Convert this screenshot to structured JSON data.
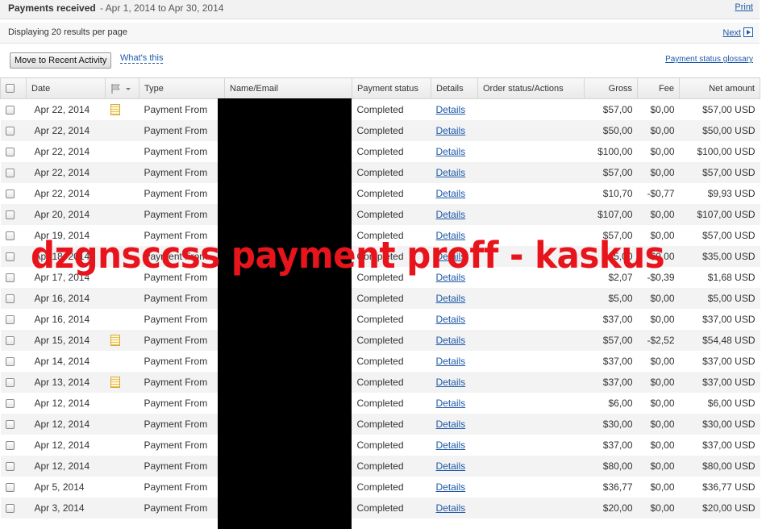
{
  "header": {
    "title": "Payments received",
    "range": "- Apr 1, 2014 to Apr 30, 2014",
    "print_label": "Print"
  },
  "subbar": {
    "per_page": "Displaying 20 results per page",
    "next_label": "Next"
  },
  "toolbar": {
    "recent_button": "Move to Recent Activity",
    "whats_this": "What's this",
    "glossary": "Payment status glossary"
  },
  "columns": {
    "date": "Date",
    "type": "Type",
    "name_email": "Name/Email",
    "status": "Payment status",
    "details": "Details",
    "order": "Order status/Actions",
    "gross": "Gross",
    "fee": "Fee",
    "net": "Net amount"
  },
  "rows": [
    {
      "date": "Apr 22, 2014",
      "note": true,
      "type": "Payment From",
      "status": "Completed",
      "details": "Details",
      "gross": "$57,00",
      "fee": "$0,00",
      "net": "$57,00 USD"
    },
    {
      "date": "Apr 22, 2014",
      "note": false,
      "type": "Payment From",
      "status": "Completed",
      "details": "Details",
      "gross": "$50,00",
      "fee": "$0,00",
      "net": "$50,00 USD"
    },
    {
      "date": "Apr 22, 2014",
      "note": false,
      "type": "Payment From",
      "status": "Completed",
      "details": "Details",
      "gross": "$100,00",
      "fee": "$0,00",
      "net": "$100,00 USD"
    },
    {
      "date": "Apr 22, 2014",
      "note": false,
      "type": "Payment From",
      "status": "Completed",
      "details": "Details",
      "gross": "$57,00",
      "fee": "$0,00",
      "net": "$57,00 USD"
    },
    {
      "date": "Apr 22, 2014",
      "note": false,
      "type": "Payment From",
      "status": "Completed",
      "details": "Details",
      "gross": "$10,70",
      "fee": "-$0,77",
      "net": "$9,93 USD"
    },
    {
      "date": "Apr 20, 2014",
      "note": false,
      "type": "Payment From",
      "status": "Completed",
      "details": "Details",
      "gross": "$107,00",
      "fee": "$0,00",
      "net": "$107,00 USD"
    },
    {
      "date": "Apr 19, 2014",
      "note": false,
      "type": "Payment From",
      "status": "Completed",
      "details": "Details",
      "gross": "$57,00",
      "fee": "$0,00",
      "net": "$57,00 USD"
    },
    {
      "date": "Apr 18, 2014",
      "note": false,
      "type": "Payment From",
      "status": "Completed",
      "details": "Details",
      "gross": "$35,00",
      "fee": "$0,00",
      "net": "$35,00 USD"
    },
    {
      "date": "Apr 17, 2014",
      "note": false,
      "type": "Payment From",
      "status": "Completed",
      "details": "Details",
      "gross": "$2,07",
      "fee": "-$0,39",
      "net": "$1,68 USD"
    },
    {
      "date": "Apr 16, 2014",
      "note": false,
      "type": "Payment From",
      "status": "Completed",
      "details": "Details",
      "gross": "$5,00",
      "fee": "$0,00",
      "net": "$5,00 USD"
    },
    {
      "date": "Apr 16, 2014",
      "note": false,
      "type": "Payment From",
      "status": "Completed",
      "details": "Details",
      "gross": "$37,00",
      "fee": "$0,00",
      "net": "$37,00 USD"
    },
    {
      "date": "Apr 15, 2014",
      "note": true,
      "type": "Payment From",
      "status": "Completed",
      "details": "Details",
      "gross": "$57,00",
      "fee": "-$2,52",
      "net": "$54,48 USD"
    },
    {
      "date": "Apr 14, 2014",
      "note": false,
      "type": "Payment From",
      "status": "Completed",
      "details": "Details",
      "gross": "$37,00",
      "fee": "$0,00",
      "net": "$37,00 USD"
    },
    {
      "date": "Apr 13, 2014",
      "note": true,
      "type": "Payment From",
      "status": "Completed",
      "details": "Details",
      "gross": "$37,00",
      "fee": "$0,00",
      "net": "$37,00 USD"
    },
    {
      "date": "Apr 12, 2014",
      "note": false,
      "type": "Payment From",
      "status": "Completed",
      "details": "Details",
      "gross": "$6,00",
      "fee": "$0,00",
      "net": "$6,00 USD"
    },
    {
      "date": "Apr 12, 2014",
      "note": false,
      "type": "Payment From",
      "status": "Completed",
      "details": "Details",
      "gross": "$30,00",
      "fee": "$0,00",
      "net": "$30,00 USD"
    },
    {
      "date": "Apr 12, 2014",
      "note": false,
      "type": "Payment From",
      "status": "Completed",
      "details": "Details",
      "gross": "$37,00",
      "fee": "$0,00",
      "net": "$37,00 USD"
    },
    {
      "date": "Apr 12, 2014",
      "note": false,
      "type": "Payment From",
      "status": "Completed",
      "details": "Details",
      "gross": "$80,00",
      "fee": "$0,00",
      "net": "$80,00 USD"
    },
    {
      "date": "Apr 5, 2014",
      "note": false,
      "type": "Payment From",
      "status": "Completed",
      "details": "Details",
      "gross": "$36,77",
      "fee": "$0,00",
      "net": "$36,77 USD"
    },
    {
      "date": "Apr 3, 2014",
      "note": false,
      "type": "Payment From",
      "status": "Completed",
      "details": "Details",
      "gross": "$20,00",
      "fee": "$0,00",
      "net": "$20,00 USD"
    }
  ],
  "watermark": "dzgnsccss payment proff - kaskus",
  "colors": {
    "link": "#1d59a8",
    "watermark": "#e8141c"
  },
  "icons": {
    "flag_header": "flag-icon",
    "row_note": "note-icon",
    "next": "next-arrow-icon"
  }
}
